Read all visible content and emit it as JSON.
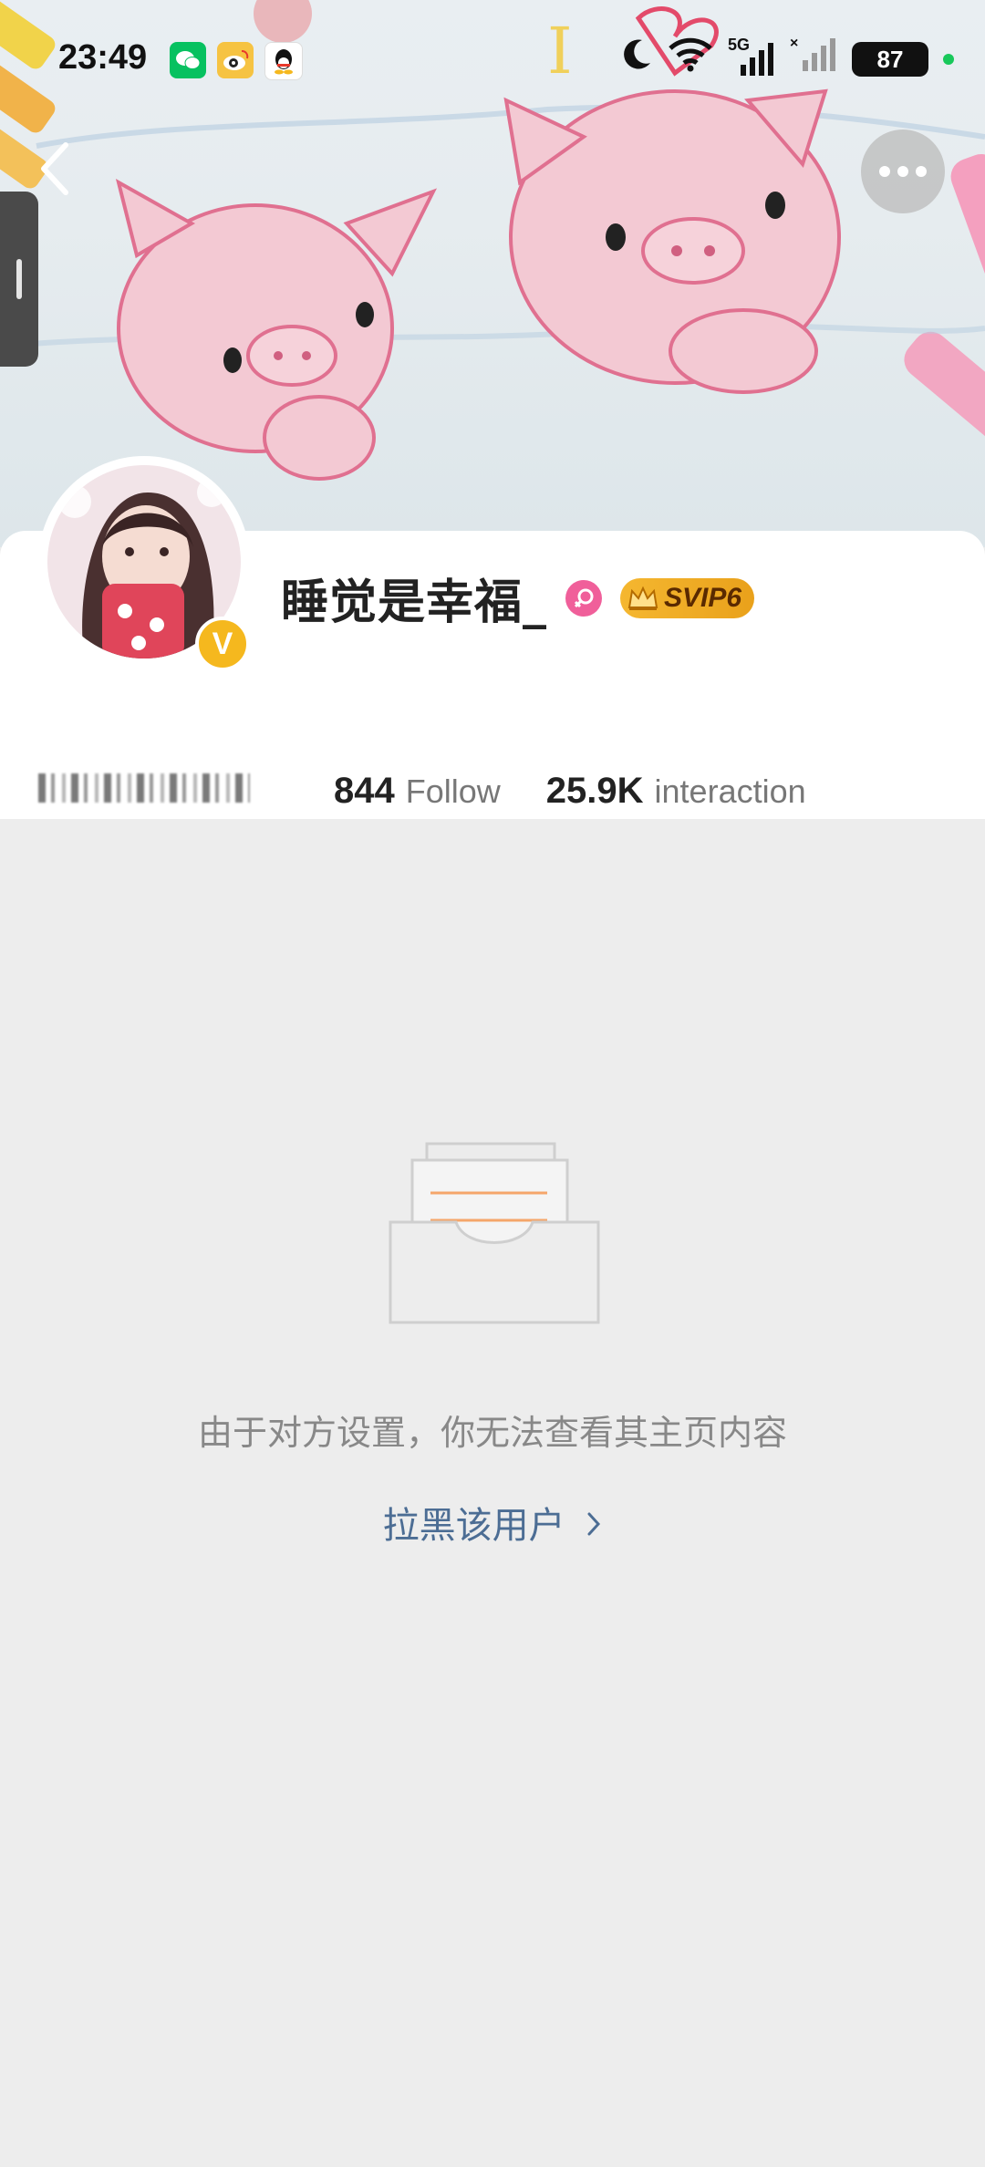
{
  "status_bar": {
    "time": "23:49",
    "battery": "87",
    "network": "5G",
    "icons": [
      "wechat-icon",
      "weibo-icon",
      "qq-icon",
      "moon-icon",
      "wifi-icon",
      "signal-icon"
    ]
  },
  "nav": {
    "back_icon": "chevron-left-icon",
    "more_icon": "more-horizontal-icon"
  },
  "profile": {
    "username": "睡觉是幸福_",
    "gender_icon": "female-icon",
    "vip_label": "SVIP6",
    "verified_badge": "V",
    "stats": {
      "follow_count": "844",
      "follow_label": "Follow",
      "interaction_count": "25.9K",
      "interaction_label": "interaction"
    }
  },
  "empty_state": {
    "message": "由于对方设置，你无法查看其主页内容",
    "action_label": "拉黑该用户"
  },
  "colors": {
    "background": "#ededed",
    "link": "#4c6d94",
    "vip_gold": "#f5b730",
    "verified": "#f5b81e",
    "gender_pink": "#f05f9a"
  }
}
